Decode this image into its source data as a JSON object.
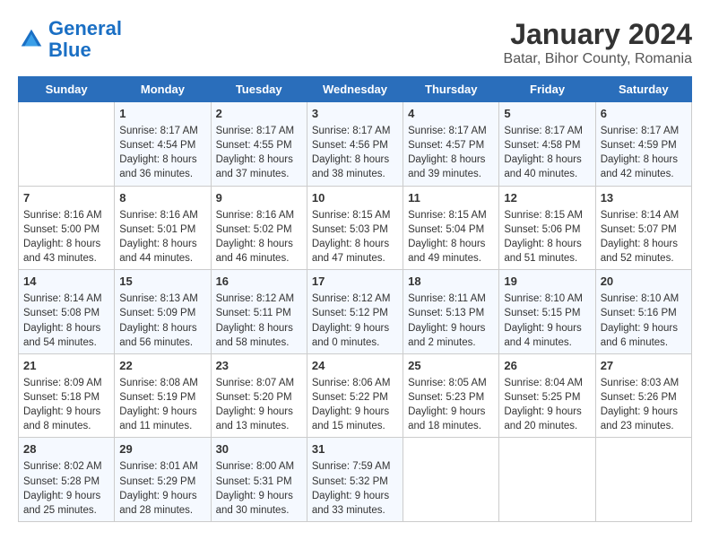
{
  "logo": {
    "line1": "General",
    "line2": "Blue"
  },
  "title": "January 2024",
  "subtitle": "Batar, Bihor County, Romania",
  "days_of_week": [
    "Sunday",
    "Monday",
    "Tuesday",
    "Wednesday",
    "Thursday",
    "Friday",
    "Saturday"
  ],
  "weeks": [
    [
      {
        "day": "",
        "sunrise": "",
        "sunset": "",
        "daylight": ""
      },
      {
        "day": "1",
        "sunrise": "Sunrise: 8:17 AM",
        "sunset": "Sunset: 4:54 PM",
        "daylight": "Daylight: 8 hours and 36 minutes."
      },
      {
        "day": "2",
        "sunrise": "Sunrise: 8:17 AM",
        "sunset": "Sunset: 4:55 PM",
        "daylight": "Daylight: 8 hours and 37 minutes."
      },
      {
        "day": "3",
        "sunrise": "Sunrise: 8:17 AM",
        "sunset": "Sunset: 4:56 PM",
        "daylight": "Daylight: 8 hours and 38 minutes."
      },
      {
        "day": "4",
        "sunrise": "Sunrise: 8:17 AM",
        "sunset": "Sunset: 4:57 PM",
        "daylight": "Daylight: 8 hours and 39 minutes."
      },
      {
        "day": "5",
        "sunrise": "Sunrise: 8:17 AM",
        "sunset": "Sunset: 4:58 PM",
        "daylight": "Daylight: 8 hours and 40 minutes."
      },
      {
        "day": "6",
        "sunrise": "Sunrise: 8:17 AM",
        "sunset": "Sunset: 4:59 PM",
        "daylight": "Daylight: 8 hours and 42 minutes."
      }
    ],
    [
      {
        "day": "7",
        "sunrise": "Sunrise: 8:16 AM",
        "sunset": "Sunset: 5:00 PM",
        "daylight": "Daylight: 8 hours and 43 minutes."
      },
      {
        "day": "8",
        "sunrise": "Sunrise: 8:16 AM",
        "sunset": "Sunset: 5:01 PM",
        "daylight": "Daylight: 8 hours and 44 minutes."
      },
      {
        "day": "9",
        "sunrise": "Sunrise: 8:16 AM",
        "sunset": "Sunset: 5:02 PM",
        "daylight": "Daylight: 8 hours and 46 minutes."
      },
      {
        "day": "10",
        "sunrise": "Sunrise: 8:15 AM",
        "sunset": "Sunset: 5:03 PM",
        "daylight": "Daylight: 8 hours and 47 minutes."
      },
      {
        "day": "11",
        "sunrise": "Sunrise: 8:15 AM",
        "sunset": "Sunset: 5:04 PM",
        "daylight": "Daylight: 8 hours and 49 minutes."
      },
      {
        "day": "12",
        "sunrise": "Sunrise: 8:15 AM",
        "sunset": "Sunset: 5:06 PM",
        "daylight": "Daylight: 8 hours and 51 minutes."
      },
      {
        "day": "13",
        "sunrise": "Sunrise: 8:14 AM",
        "sunset": "Sunset: 5:07 PM",
        "daylight": "Daylight: 8 hours and 52 minutes."
      }
    ],
    [
      {
        "day": "14",
        "sunrise": "Sunrise: 8:14 AM",
        "sunset": "Sunset: 5:08 PM",
        "daylight": "Daylight: 8 hours and 54 minutes."
      },
      {
        "day": "15",
        "sunrise": "Sunrise: 8:13 AM",
        "sunset": "Sunset: 5:09 PM",
        "daylight": "Daylight: 8 hours and 56 minutes."
      },
      {
        "day": "16",
        "sunrise": "Sunrise: 8:12 AM",
        "sunset": "Sunset: 5:11 PM",
        "daylight": "Daylight: 8 hours and 58 minutes."
      },
      {
        "day": "17",
        "sunrise": "Sunrise: 8:12 AM",
        "sunset": "Sunset: 5:12 PM",
        "daylight": "Daylight: 9 hours and 0 minutes."
      },
      {
        "day": "18",
        "sunrise": "Sunrise: 8:11 AM",
        "sunset": "Sunset: 5:13 PM",
        "daylight": "Daylight: 9 hours and 2 minutes."
      },
      {
        "day": "19",
        "sunrise": "Sunrise: 8:10 AM",
        "sunset": "Sunset: 5:15 PM",
        "daylight": "Daylight: 9 hours and 4 minutes."
      },
      {
        "day": "20",
        "sunrise": "Sunrise: 8:10 AM",
        "sunset": "Sunset: 5:16 PM",
        "daylight": "Daylight: 9 hours and 6 minutes."
      }
    ],
    [
      {
        "day": "21",
        "sunrise": "Sunrise: 8:09 AM",
        "sunset": "Sunset: 5:18 PM",
        "daylight": "Daylight: 9 hours and 8 minutes."
      },
      {
        "day": "22",
        "sunrise": "Sunrise: 8:08 AM",
        "sunset": "Sunset: 5:19 PM",
        "daylight": "Daylight: 9 hours and 11 minutes."
      },
      {
        "day": "23",
        "sunrise": "Sunrise: 8:07 AM",
        "sunset": "Sunset: 5:20 PM",
        "daylight": "Daylight: 9 hours and 13 minutes."
      },
      {
        "day": "24",
        "sunrise": "Sunrise: 8:06 AM",
        "sunset": "Sunset: 5:22 PM",
        "daylight": "Daylight: 9 hours and 15 minutes."
      },
      {
        "day": "25",
        "sunrise": "Sunrise: 8:05 AM",
        "sunset": "Sunset: 5:23 PM",
        "daylight": "Daylight: 9 hours and 18 minutes."
      },
      {
        "day": "26",
        "sunrise": "Sunrise: 8:04 AM",
        "sunset": "Sunset: 5:25 PM",
        "daylight": "Daylight: 9 hours and 20 minutes."
      },
      {
        "day": "27",
        "sunrise": "Sunrise: 8:03 AM",
        "sunset": "Sunset: 5:26 PM",
        "daylight": "Daylight: 9 hours and 23 minutes."
      }
    ],
    [
      {
        "day": "28",
        "sunrise": "Sunrise: 8:02 AM",
        "sunset": "Sunset: 5:28 PM",
        "daylight": "Daylight: 9 hours and 25 minutes."
      },
      {
        "day": "29",
        "sunrise": "Sunrise: 8:01 AM",
        "sunset": "Sunset: 5:29 PM",
        "daylight": "Daylight: 9 hours and 28 minutes."
      },
      {
        "day": "30",
        "sunrise": "Sunrise: 8:00 AM",
        "sunset": "Sunset: 5:31 PM",
        "daylight": "Daylight: 9 hours and 30 minutes."
      },
      {
        "day": "31",
        "sunrise": "Sunrise: 7:59 AM",
        "sunset": "Sunset: 5:32 PM",
        "daylight": "Daylight: 9 hours and 33 minutes."
      },
      {
        "day": "",
        "sunrise": "",
        "sunset": "",
        "daylight": ""
      },
      {
        "day": "",
        "sunrise": "",
        "sunset": "",
        "daylight": ""
      },
      {
        "day": "",
        "sunrise": "",
        "sunset": "",
        "daylight": ""
      }
    ]
  ]
}
